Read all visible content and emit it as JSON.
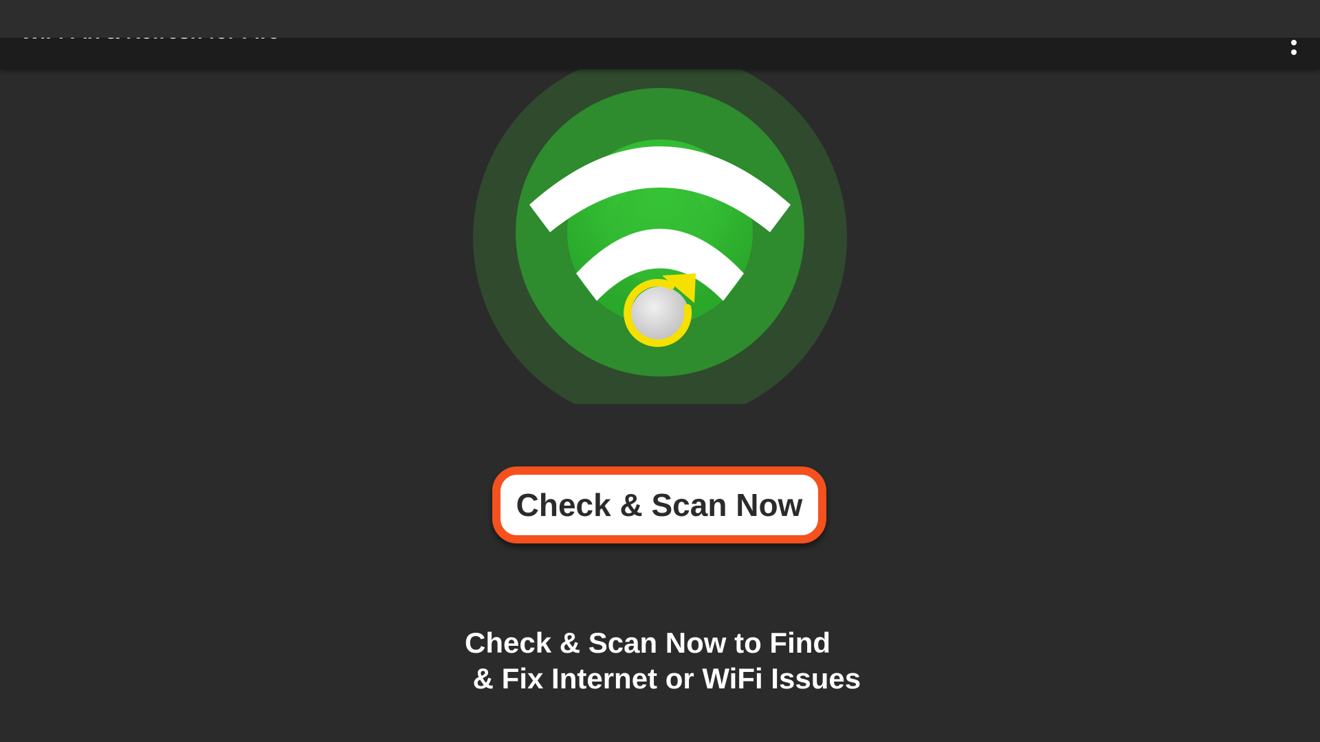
{
  "toolbar": {
    "title": "WiFi Fix & Refresh for Fire",
    "menu_icon": "more-vert-icon"
  },
  "logo": {
    "icon": "wifi-refresh-logo-icon",
    "colors": {
      "outer_glow": "#2f4a2d",
      "ring": "#2e8b2e",
      "inner": "#32b432",
      "arcs": "#ffffff",
      "refresh": "#f5e000",
      "knob": "#d8d8d8"
    }
  },
  "scan_button": {
    "label": "Check & Scan Now",
    "border_color": "#f4511e"
  },
  "description": {
    "line1": "Check & Scan Now to Find",
    "line2": " & Fix Internet or WiFi Issues"
  }
}
